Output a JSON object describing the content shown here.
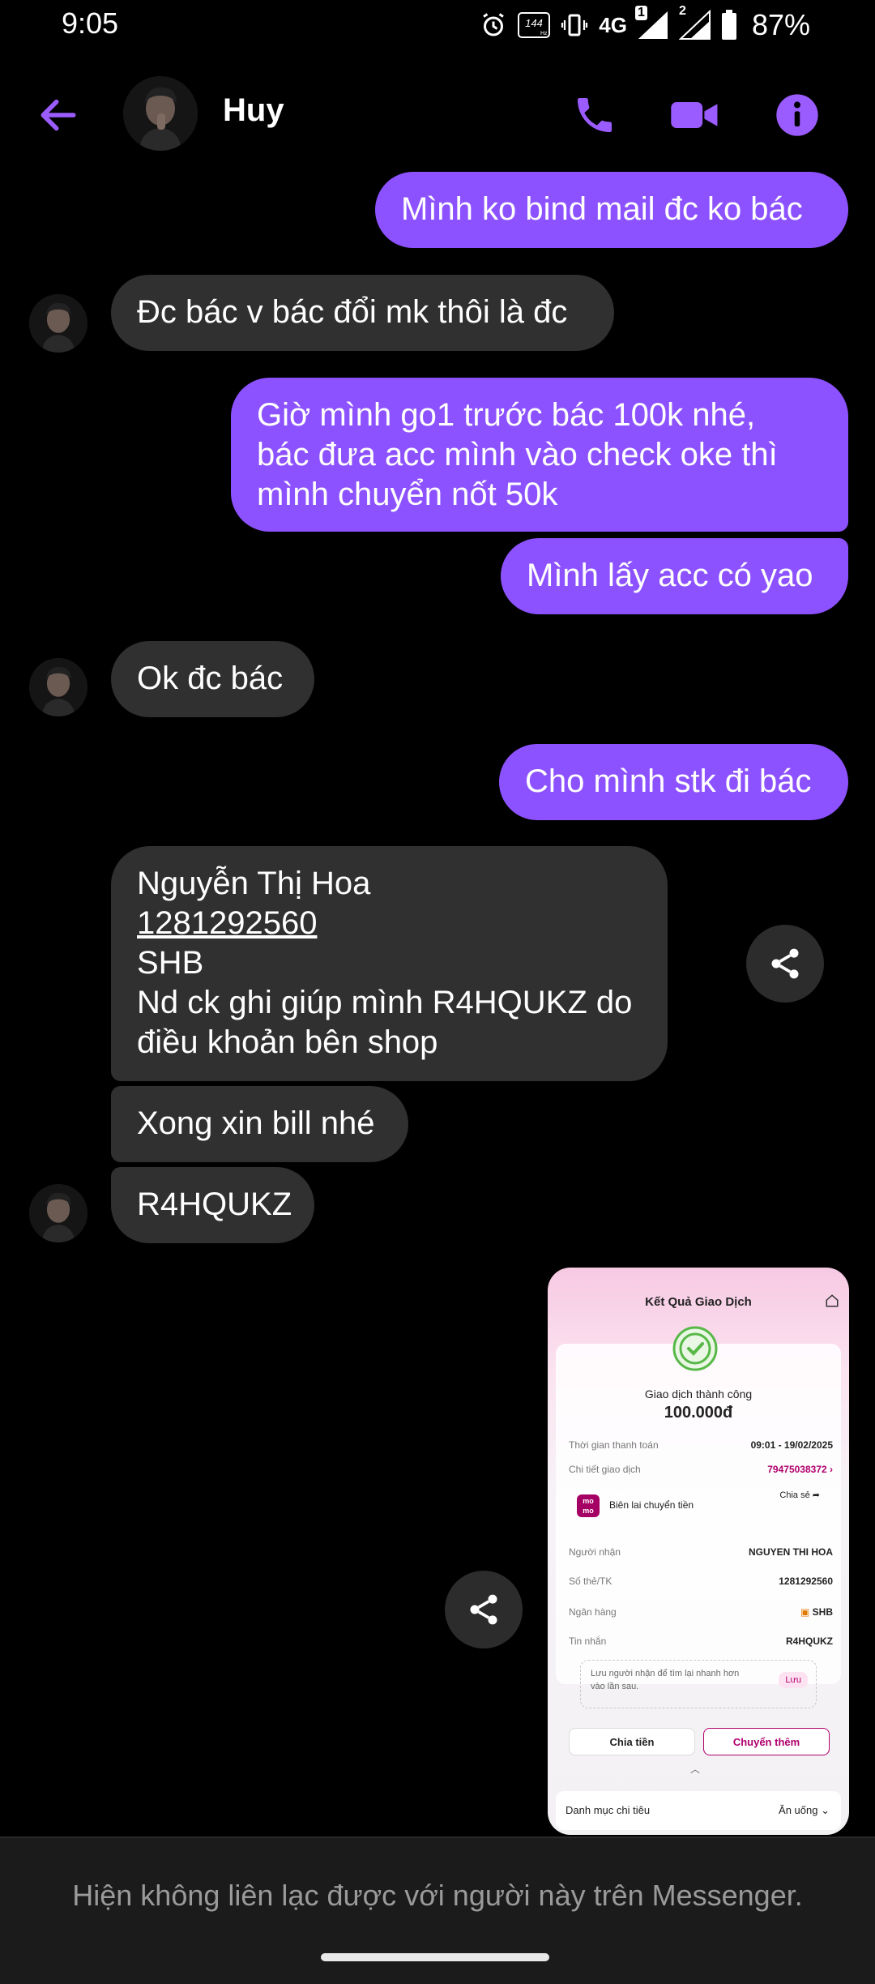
{
  "status_bar": {
    "time": "9:05",
    "network": "4G",
    "battery": "87%",
    "refresh_rate": "144",
    "sim_badge_1": "1",
    "sim_badge_2": "2"
  },
  "header": {
    "contact_name": "Huy",
    "accent_color": "#9b5cff"
  },
  "messages": [
    {
      "dir": "out",
      "text": "Mình ko bind mail đc ko bác"
    },
    {
      "dir": "in",
      "text": "Đc bác v bác đổi mk thôi là đc"
    },
    {
      "dir": "out",
      "text": "Giờ mình go1 trước bác 100k nhé,\nbác đưa acc mình vào check oke thì\nmình chuyển nốt 50k"
    },
    {
      "dir": "out",
      "text": "Mình lấy acc có yao"
    },
    {
      "dir": "in",
      "text": "Ok đc bác"
    },
    {
      "dir": "out",
      "text": "Cho mình stk đi bác"
    },
    {
      "dir": "in",
      "lines": [
        "Nguyễn Thị Hoa",
        "1281292560",
        "SHB",
        "Nd ck ghi giúp mình R4HQUKZ do",
        "điều khoản bên shop"
      ]
    },
    {
      "dir": "in",
      "text": "Xong xin bill nhé"
    },
    {
      "dir": "in",
      "text": "R4HQUKZ"
    }
  ],
  "receipt": {
    "title": "Kết Quả Giao Dịch",
    "status": "Giao dịch thành công",
    "amount": "100.000đ",
    "time_label": "Thời gian thanh toán",
    "time_value": "09:01 - 19/02/2025",
    "detail_label": "Chi tiết giao dịch",
    "detail_value": "79475038372 ›",
    "momo_logo_line1": "mo",
    "momo_logo_line2": "mo",
    "momo_label": "Biên lai chuyển tiền",
    "share_label": "Chia sẻ",
    "recipient_label": "Người nhận",
    "recipient_value": "NGUYEN THI HOA",
    "account_label": "Số thẻ/TK",
    "account_value": "1281292560",
    "bank_label": "Ngân hàng",
    "bank_value": "SHB",
    "message_label": "Tin nhắn",
    "message_value": "R4HQUKZ",
    "note_text": "Lưu người nhận để tìm lại nhanh hơn vào lần sau.",
    "save_label": "Lưu",
    "split_button": "Chia tiền",
    "transfer_more_button": "Chuyển thêm",
    "category_label": "Danh mục chi tiêu",
    "category_value": "Ăn uống"
  },
  "footer": {
    "unavailable_text": "Hiện không liên lạc được với người này trên Messenger."
  }
}
